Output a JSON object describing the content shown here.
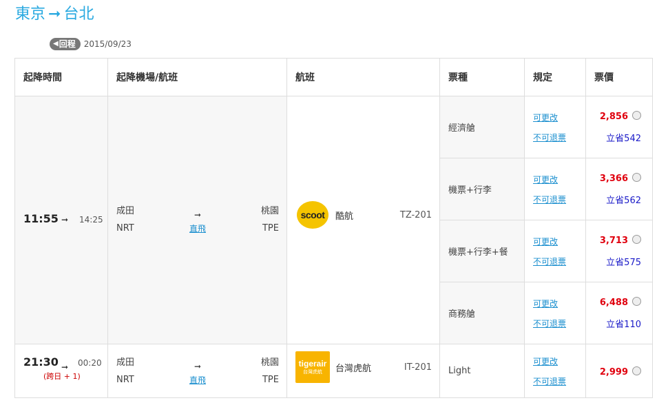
{
  "route": {
    "from": "東京",
    "arrow": "➞",
    "to": "台北"
  },
  "return": {
    "badge_icon": "◀",
    "badge_label": "回程",
    "date": "2015/09/23"
  },
  "headers": [
    "起降時間",
    "起降機場/航班",
    "航班",
    "票種",
    "規定",
    "票價"
  ],
  "flights": [
    {
      "depart": "11:55",
      "arrow": "➞",
      "arrive": "14:25",
      "next_day": "",
      "from_airport": "成田",
      "from_code": "NRT",
      "to_airport": "桃園",
      "to_code": "TPE",
      "mid_arrow": "➞",
      "direct_label": "直飛",
      "logo_text": "scoot",
      "airline": "酷航",
      "flight_no": "TZ-201",
      "fares": [
        {
          "type": "經濟艙",
          "change": "可更改",
          "refund": "不可退票",
          "price": "2,856",
          "save": "立省542"
        },
        {
          "type": "機票+行李",
          "change": "可更改",
          "refund": "不可退票",
          "price": "3,366",
          "save": "立省562"
        },
        {
          "type": "機票+行李+餐",
          "change": "可更改",
          "refund": "不可退票",
          "price": "3,713",
          "save": "立省575"
        },
        {
          "type": "商務艙",
          "change": "可更改",
          "refund": "不可退票",
          "price": "6,488",
          "save": "立省110"
        }
      ]
    },
    {
      "depart": "21:30",
      "arrow": "➞",
      "arrive": "00:20",
      "next_day": "(跨日 + 1)",
      "from_airport": "成田",
      "from_code": "NRT",
      "to_airport": "桃園",
      "to_code": "TPE",
      "mid_arrow": "➞",
      "direct_label": "直飛",
      "logo_text": "tigerair",
      "logo_sub": "台灣虎航",
      "airline": "台灣虎航",
      "flight_no": "IT-201",
      "fares": [
        {
          "type": "Light",
          "change": "可更改",
          "refund": "不可退票",
          "price": "2,999",
          "save": ""
        }
      ]
    }
  ],
  "colors": {
    "accent": "#29a9e0",
    "price": "#e0000e",
    "save": "#1a1ac8",
    "link": "#1b8fcf",
    "logo_scoot": "#f5c400",
    "logo_tiger": "#f8b400"
  }
}
